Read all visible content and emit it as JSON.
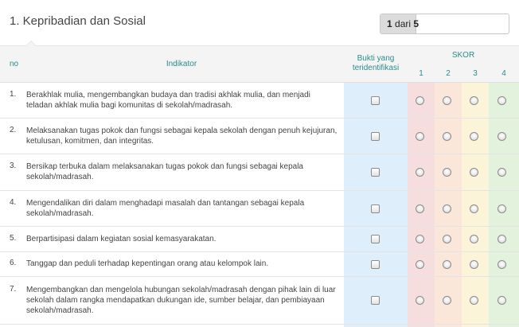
{
  "section": {
    "title": "1. Kepribadian dan Sosial"
  },
  "pager": {
    "current": "1",
    "separator": "dari",
    "total": "5",
    "fill_fraction": 0.28
  },
  "table": {
    "headers": {
      "no": "no",
      "indikator": "Indikator",
      "bukti_line1": "Bukti yang",
      "bukti_line2": "teridentifikasi",
      "skor": "SKOR",
      "skor_values": [
        "1",
        "2",
        "3",
        "4"
      ]
    },
    "colors": {
      "bukti": "#dfeefb",
      "skor1": "#f7dede",
      "skor2": "#fbe7d9",
      "skor3": "#fbf4d9",
      "skor4": "#e3f2dc"
    },
    "rows": [
      {
        "no": "1.",
        "text": "Berakhlak mulia, mengembangkan budaya dan tradisi akhlak mulia, dan menjadi teladan akhlak mulia bagi komunitas di sekolah/madrasah."
      },
      {
        "no": "2.",
        "text": "Melaksanakan tugas pokok dan fungsi sebagai kepala sekolah dengan penuh kejujuran, ketulusan, komitmen, dan integritas."
      },
      {
        "no": "3.",
        "text": "Bersikap terbuka dalam melaksanakan tugas pokok dan fungsi sebagai kepala sekolah/madrasah."
      },
      {
        "no": "4.",
        "text": "Mengendalikan diri dalam menghadapi masalah dan tantangan sebagai kepala sekolah/madrasah."
      },
      {
        "no": "5.",
        "text": "Berpartisipasi dalam kegiatan sosial kemasyarakatan."
      },
      {
        "no": "6.",
        "text": "Tanggap dan peduli terhadap kepentingan orang atau kelompok lain."
      },
      {
        "no": "7.",
        "text": "Mengembangkan dan mengelola hubungan sekolah/madrasah dengan pihak lain di luar sekolah dalam rangka mendapatkan dukungan ide, sumber belajar, dan pembiayaan sekolah/madrasah."
      }
    ]
  }
}
